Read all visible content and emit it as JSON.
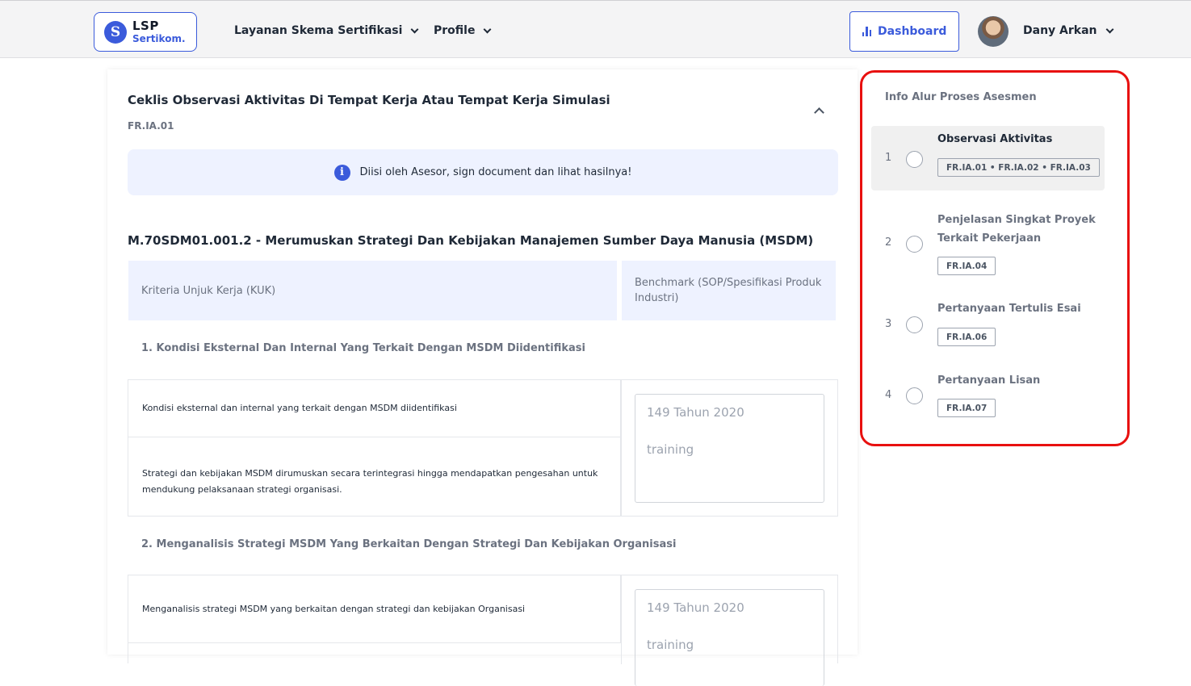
{
  "nav": {
    "logo_line1": "LSP",
    "logo_line2": "Sertikom.",
    "logo_mark": "S",
    "menu_schemes": "Layanan Skema Sertifikasi",
    "menu_profile": "Profile",
    "dashboard_label": "Dashboard",
    "user_name": "Dany Arkan"
  },
  "main": {
    "title": "Ceklis Observasi Aktivitas Di Tempat Kerja Atau Tempat Kerja Simulasi",
    "form_code": "FR.IA.01",
    "info_text": "Diisi oleh Asesor, sign document dan lihat hasilnya!",
    "unit_title": "M.70SDM01.001.2 - Merumuskan Strategi Dan Kebijakan Manajemen Sumber Daya Manusia (MSDM)",
    "col_kuk": "Kriteria Unjuk Kerja (KUK)",
    "col_benchmark": "Benchmark (SOP/Spesifikasi Produk Industri)",
    "elements": [
      {
        "title": "1. Kondisi Eksternal Dan Internal Yang Terkait Dengan MSDM Diidentifikasi",
        "kuk": [
          "Kondisi eksternal dan internal yang terkait dengan MSDM diidentifikasi",
          "Strategi dan kebijakan MSDM dirumuskan secara terintegrasi hingga mendapatkan pengesahan untuk mendukung pelaksanaan strategi organisasi."
        ],
        "benchmark_line1": "149 Tahun 2020",
        "benchmark_line2": "training"
      },
      {
        "title": "2. Menganalisis Strategi MSDM Yang Berkaitan Dengan Strategi Dan Kebijakan Organisasi",
        "kuk": [
          "Menganalisis strategi MSDM yang berkaitan dengan strategi dan kebijakan Organisasi"
        ],
        "benchmark_line1": "149 Tahun 2020",
        "benchmark_line2": "training"
      }
    ]
  },
  "sidebar": {
    "title": "Info Alur Proses Asesmen",
    "steps": [
      {
        "num": "1",
        "label": "Observasi Aktivitas",
        "tag": "FR.IA.01 • FR.IA.02 • FR.IA.03"
      },
      {
        "num": "2",
        "label": "Penjelasan Singkat Proyek Terkait Pekerjaan",
        "tag": "FR.IA.04"
      },
      {
        "num": "3",
        "label": "Pertanyaan Tertulis Esai",
        "tag": "FR.IA.06"
      },
      {
        "num": "4",
        "label": "Pertanyaan Lisan",
        "tag": "FR.IA.07"
      }
    ]
  },
  "colors": {
    "accent": "#3b5bdb",
    "highlight_border": "#e8100f",
    "info_bg": "#eef2ff"
  }
}
